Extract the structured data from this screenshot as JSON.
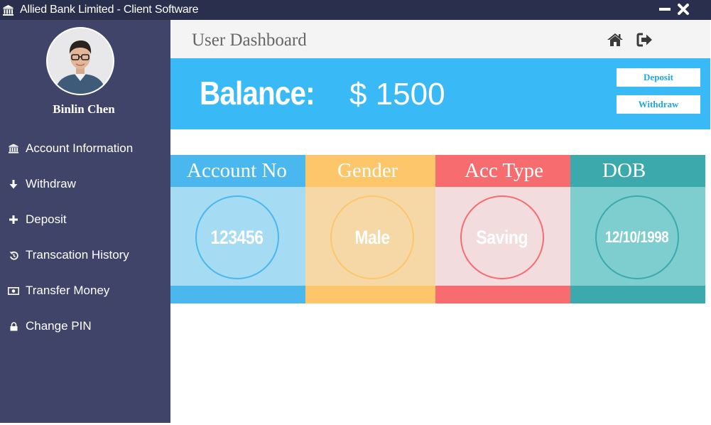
{
  "window": {
    "title": "Allied Bank Limited - Client Software",
    "app_icon": "bank-icon",
    "minimize_icon": "minimize-icon",
    "close_icon": "close-icon"
  },
  "sidebar": {
    "user_name": "Binlin Chen",
    "items": [
      {
        "label": "Account Information",
        "icon": "bank-icon"
      },
      {
        "label": "Withdraw",
        "icon": "arrow-down-icon"
      },
      {
        "label": "Deposit",
        "icon": "plus-icon"
      },
      {
        "label": "Transcation History",
        "icon": "history-icon"
      },
      {
        "label": "Transfer Money",
        "icon": "money-icon"
      },
      {
        "label": "Change PIN",
        "icon": "lock-icon"
      }
    ]
  },
  "header": {
    "title": "User Dashboard",
    "home_icon": "home-icon",
    "logout_icon": "sign-out-icon"
  },
  "balance": {
    "label": "Balance:",
    "value": "$ 1500",
    "deposit_label": "Deposit",
    "withdraw_label": "Withdraw"
  },
  "cards": [
    {
      "title": "Account No",
      "value": "123456"
    },
    {
      "title": "Gender",
      "value": "Male"
    },
    {
      "title": "Acc Type",
      "value": "Saving"
    },
    {
      "title": "DOB",
      "value": "12/10/1998"
    }
  ],
  "colors": {
    "titlebar": "#2b2f4e",
    "sidebar": "#3f4468",
    "balance_banner": "#39b9f6",
    "card_blue": "#4ab8ee",
    "card_orange": "#fec66a",
    "card_red": "#f76d6f",
    "card_teal": "#3caaad"
  }
}
